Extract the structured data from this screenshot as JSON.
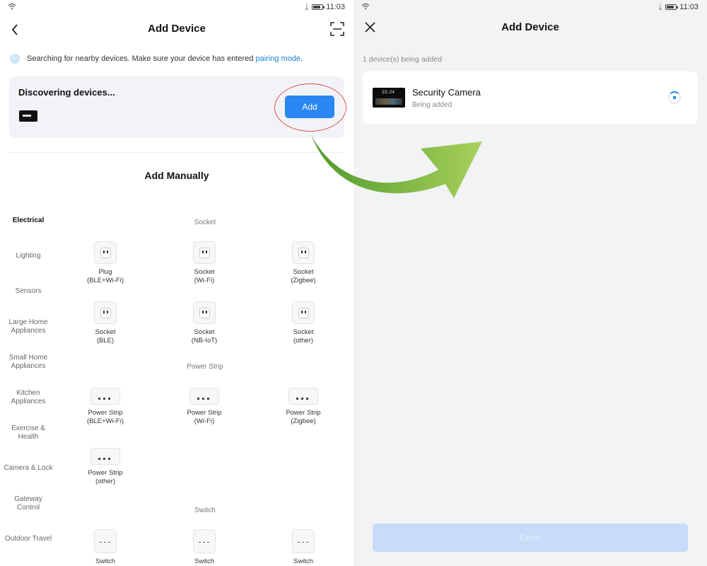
{
  "colors": {
    "accent": "#2a86f1",
    "highlight_ring": "#e24b4b",
    "arrow": "#8dbd3b",
    "done_disabled": "#c6dcf8"
  },
  "left": {
    "status": {
      "time": "11:03",
      "icons": [
        "wifi-icon",
        "bluetooth-icon",
        "battery-icon"
      ]
    },
    "header": {
      "title": "Add Device",
      "back_icon": "chevron-left-icon",
      "scan_icon": "scan-icon"
    },
    "tip": {
      "text": "Searching for nearby devices. Make sure your device has entered ",
      "link": "pairing mode",
      "suffix": "."
    },
    "discovery": {
      "heading": "Discovering devices...",
      "add_label": "Add"
    },
    "manual": {
      "title": "Add Manually",
      "categories": [
        "Electrical",
        "Lighting",
        "Sensors",
        "Large Home\nAppliances",
        "Small Home\nAppliances",
        "Kitchen\nAppliances",
        "Exercise &\nHealth",
        "Camera & Lock",
        "Gateway\nControl",
        "Outdoor Travel"
      ],
      "sections": [
        {
          "label": "Socket",
          "devices": [
            "Plug\n(BLE+Wi-Fi)",
            "Socket\n(Wi-Fi)",
            "Socket\n(Zigbee)",
            "Socket\n(BLE)",
            "Socket\n(NB-IoT)",
            "Socket\n(other)"
          ]
        },
        {
          "label": "Power Strip",
          "devices": [
            "Power Strip\n(BLE+Wi-Fi)",
            "Power Strip\n(Wi-Fi)",
            "Power Strip\n(Zigbee)",
            "Power Strip\n(other)"
          ]
        },
        {
          "label": "Switch",
          "devices": [
            "Switch",
            "Switch",
            "Switch"
          ]
        }
      ]
    }
  },
  "right": {
    "status": {
      "time": "11:03"
    },
    "header": {
      "title": "Add Device",
      "close_icon": "close-icon"
    },
    "count_text": "1 device(s) being added",
    "device": {
      "name": "Security Camera",
      "status": "Being added",
      "screen_time": "23:24"
    },
    "done_label": "Done"
  }
}
